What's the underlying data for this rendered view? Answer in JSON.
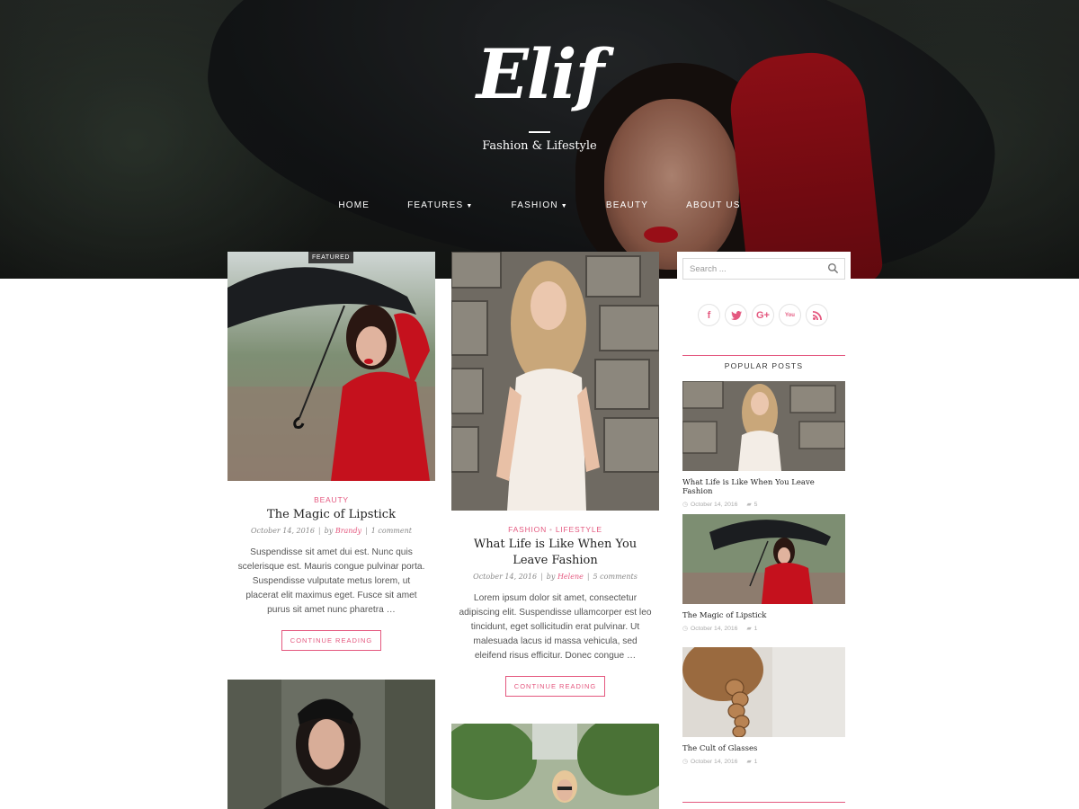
{
  "site": {
    "logo": "Elif",
    "tagline": "Fashion & Lifestyle"
  },
  "nav": {
    "items": [
      {
        "label": "HOME",
        "dropdown": false
      },
      {
        "label": "FEATURES",
        "dropdown": true
      },
      {
        "label": "FASHION",
        "dropdown": true
      },
      {
        "label": "BEAUTY",
        "dropdown": false
      },
      {
        "label": "ABOUT US",
        "dropdown": false
      }
    ]
  },
  "posts": [
    {
      "badge": "FEATURED",
      "categories": [
        "BEAUTY"
      ],
      "title": "The Magic of Lipstick",
      "date": "October 14, 2016",
      "by": "by",
      "author": "Brandy",
      "comments": "1 comment",
      "excerpt": "Suspendisse sit amet dui est. Nunc quis scelerisque est. Mauris congue pulvinar porta. Suspendisse vulputate metus lorem, ut placerat elit maximus eget. Fusce sit amet purus sit amet nunc pharetra …",
      "button": "CONTINUE READING"
    },
    {
      "categories": [
        "FASHION",
        "LIFESTYLE"
      ],
      "title": "What Life is Like When You Leave Fashion",
      "date": "October 14, 2016",
      "by": "by",
      "author": "Helene",
      "comments": "5 comments",
      "excerpt": "Lorem ipsum dolor sit amet, consectetur adipiscing elit. Suspendisse ullamcorper est leo tincidunt, eget sollicitudin erat pulvinar. Ut malesuada lacus id massa vehicula, sed eleifend risus efficitur. Donec congue …",
      "button": "CONTINUE READING"
    }
  ],
  "sidebar": {
    "search_placeholder": "Search ...",
    "socials": [
      "f",
      "t",
      "G+",
      "You",
      "rss"
    ],
    "popular_title": "POPULAR POSTS",
    "popular": [
      {
        "title": "What Life is Like When You Leave Fashion",
        "date": "October 14, 2016",
        "comments": "5"
      },
      {
        "title": "The Magic of Lipstick",
        "date": "October 14, 2016",
        "comments": "1"
      },
      {
        "title": "The Cult of Glasses",
        "date": "October 14, 2016",
        "comments": "1"
      }
    ]
  },
  "colors": {
    "accent": "#e4587f",
    "title": "#222222",
    "body": "#555555"
  }
}
